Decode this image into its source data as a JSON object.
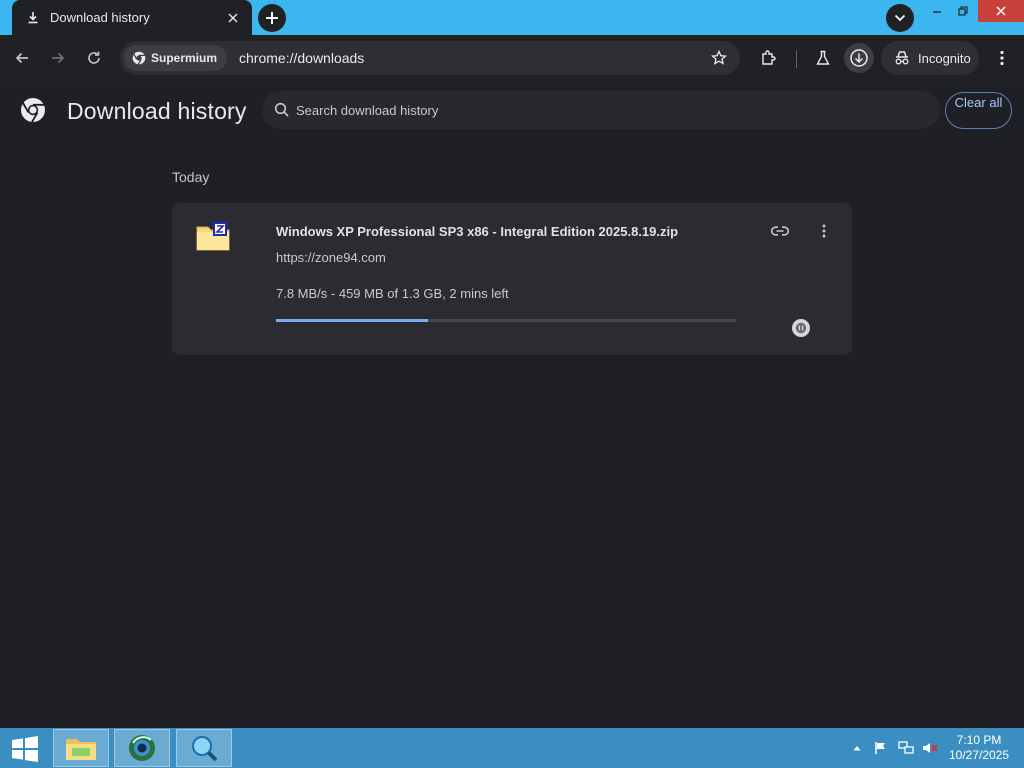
{
  "tab": {
    "title": "Download history",
    "icon": "download-icon",
    "close": "✕"
  },
  "toolbar": {
    "site_chip": "Supermium",
    "url": "chrome://downloads",
    "incognito_label": "Incognito"
  },
  "page": {
    "title": "Download history",
    "search_placeholder": "Search download history",
    "clear_all": "Clear all"
  },
  "downloads": {
    "section": "Today",
    "items": [
      {
        "file_name": "Windows XP Professional SP3 x86 - Integral Edition 2025.8.19.zip",
        "url": "https://zone94.com",
        "status": "7.8 MB/s - 459 MB of 1.3 GB, 2 mins left",
        "progress": 0.33
      }
    ]
  },
  "taskbar": {
    "time": "7:10 PM",
    "date": "10/27/2025"
  },
  "colors": {
    "accent": "#7cacf8",
    "titlebar": "#3cb6ef",
    "taskbar": "#3a8ec2",
    "background": "#1f1f26"
  }
}
